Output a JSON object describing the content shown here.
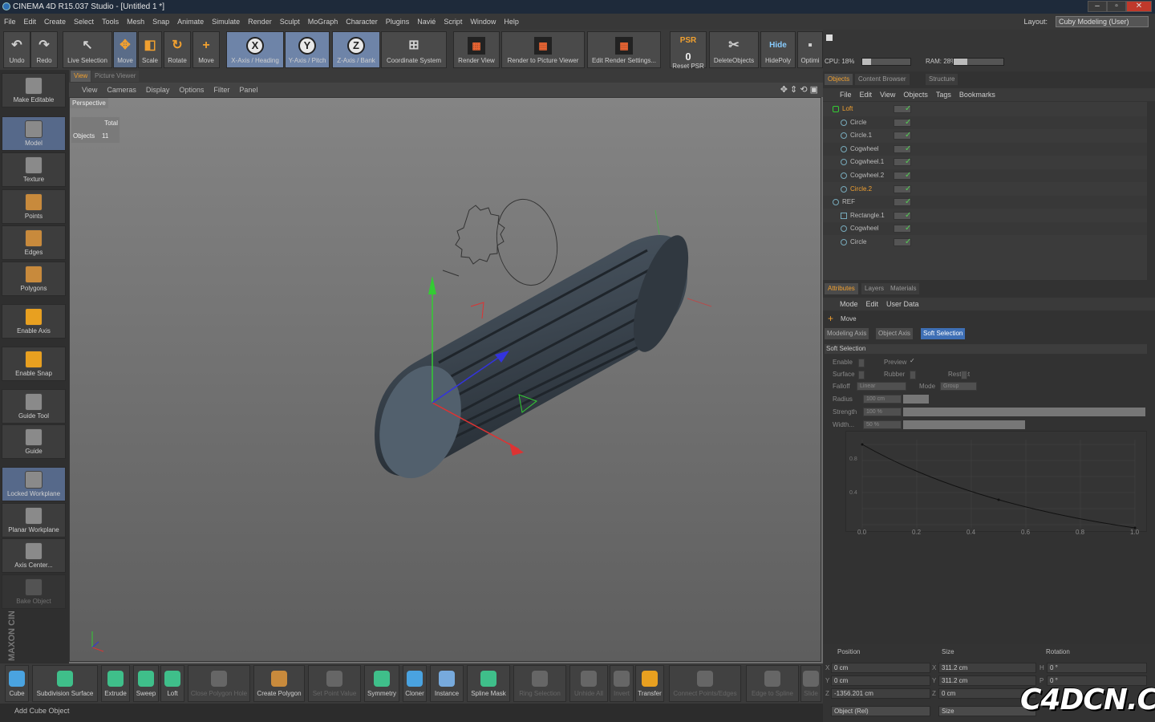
{
  "window": {
    "title": "CINEMA 4D R15.037 Studio - [Untitled 1 *]",
    "btns": [
      "–",
      "▫",
      "✕"
    ]
  },
  "menu": [
    "File",
    "Edit",
    "Create",
    "Select",
    "Tools",
    "Mesh",
    "Snap",
    "Animate",
    "Simulate",
    "Render",
    "Sculpt",
    "MoGraph",
    "Character",
    "Plugins",
    "Navié",
    "Script",
    "Window",
    "Help"
  ],
  "layout": {
    "label": "Layout:",
    "value": "Cuby Modeling (User)"
  },
  "toolbar": [
    {
      "label": "Undo",
      "icon": "↶"
    },
    {
      "label": "Redo",
      "icon": "↷"
    },
    {
      "label": "Live Selection",
      "icon": "↖"
    },
    {
      "label": "Move",
      "icon": "✥"
    },
    {
      "label": "Scale",
      "icon": "◧"
    },
    {
      "label": "Rotate",
      "icon": "↻"
    },
    {
      "label": "Move",
      "icon": "+"
    },
    {
      "label": "X-Axis / Heading",
      "icon": "X"
    },
    {
      "label": "Y-Axis / Pitch",
      "icon": "Y"
    },
    {
      "label": "Z-Axis / Bank",
      "icon": "Z"
    },
    {
      "label": "Coordinate System",
      "icon": "⊞"
    },
    {
      "label": "Render View",
      "icon": "▦"
    },
    {
      "label": "Render to Picture Viewer",
      "icon": "▦"
    },
    {
      "label": "Edit Render Settings...",
      "icon": "▦"
    },
    {
      "label": "Reset PSR",
      "icon": "PSR"
    },
    {
      "label": "DeleteObjects",
      "icon": "✂"
    },
    {
      "label": "HidePoly",
      "icon": "Hide"
    },
    {
      "label": "Optimi",
      "icon": "▪"
    }
  ],
  "psr_value": "0",
  "left_tools": [
    "Make Editable",
    "Model",
    "Texture",
    "Points",
    "Edges",
    "Polygons",
    "Enable Axis",
    "Enable Snap",
    "Guide Tool",
    "Guide",
    "Locked Workplane",
    "Planar Workplane",
    "Axis Center...",
    "Bake Object"
  ],
  "maxon": "MAXON CINEMA 4D",
  "viewport": {
    "tabs": [
      "View",
      "Picture Viewer"
    ],
    "menu": [
      "View",
      "Cameras",
      "Display",
      "Options",
      "Filter",
      "Panel"
    ],
    "camera": "Perspective",
    "stats": {
      "col": "Total",
      "row": "Objects",
      "value": "11"
    }
  },
  "perf": {
    "cpu": "CPU: 18%",
    "ram": "RAM: 28%",
    "cpu_level": 0.18,
    "ram_level": 0.28
  },
  "obj_tabs": [
    "Objects",
    "Content Browser",
    "Structure"
  ],
  "obj_menu": [
    "File",
    "Edit",
    "View",
    "Objects",
    "Tags",
    "Bookmarks"
  ],
  "objects": [
    {
      "name": "Loft",
      "indent": 0,
      "hl": true
    },
    {
      "name": "Circle",
      "indent": 1
    },
    {
      "name": "Circle.1",
      "indent": 1
    },
    {
      "name": "Cogwheel",
      "indent": 1
    },
    {
      "name": "Cogwheel.1",
      "indent": 1
    },
    {
      "name": "Cogwheel.2",
      "indent": 1
    },
    {
      "name": "Circle.2",
      "indent": 1,
      "hl": true
    },
    {
      "name": "REF",
      "indent": 0
    },
    {
      "name": "Rectangle.1",
      "indent": 1
    },
    {
      "name": "Cogwheel",
      "indent": 1
    },
    {
      "name": "Circle",
      "indent": 1
    }
  ],
  "attr_tabs": [
    "Attributes",
    "Layers",
    "Materials"
  ],
  "attr_menu": [
    "Mode",
    "Edit",
    "User Data"
  ],
  "tool_name": "Move",
  "attr_subtabs": [
    "Modeling Axis",
    "Object Axis",
    "Soft Selection"
  ],
  "soft": {
    "title": "Soft Selection",
    "enable": "Enable",
    "preview": "Preview",
    "surface": "Surface",
    "rubber": "Rubber",
    "restrict": "Restrict",
    "falloff": "Falloff",
    "falloff_val": "Linear",
    "mode": "Mode",
    "mode_val": "Group",
    "radius": "Radius",
    "radius_val": "100 cm",
    "strength": "Strength",
    "strength_val": "100 %",
    "width": "Width...",
    "width_val": "50 %",
    "yticks": [
      "0.8",
      "0.4"
    ],
    "xticks": [
      "0.0",
      "0.2",
      "0.4",
      "0.6",
      "0.8",
      "1.0"
    ]
  },
  "coord": {
    "position": "Position",
    "size": "Size",
    "rotation": "Rotation",
    "x": "0 cm",
    "y": "0 cm",
    "z": "-1356.201 cm",
    "sx": "311.2 cm",
    "sy": "311.2 cm",
    "sz": "0 cm",
    "h": "0 °",
    "p": "0 °",
    "mode": "Object (Rel)",
    "mode2": "Size"
  },
  "bottom": [
    {
      "label": "Cube",
      "color": "#4aa3e0"
    },
    {
      "label": "Subdivision Surface",
      "color": "#3fbf8a"
    },
    {
      "label": "Extrude",
      "color": "#3fbf8a"
    },
    {
      "label": "Sweep",
      "color": "#3fbf8a"
    },
    {
      "label": "Loft",
      "color": "#3fbf8a"
    },
    {
      "label": "Close Polygon Hole",
      "color": "#666",
      "dim": true
    },
    {
      "label": "Create Polygon",
      "color": "#c88a3c"
    },
    {
      "label": "Set Point Value",
      "color": "#666",
      "dim": true
    },
    {
      "label": "Symmetry",
      "color": "#3fbf8a"
    },
    {
      "label": "Cloner",
      "color": "#4aa3e0"
    },
    {
      "label": "Instance",
      "color": "#7ad"
    },
    {
      "label": "Spline Mask",
      "color": "#3fbf8a"
    },
    {
      "label": "Ring Selection",
      "color": "#666",
      "dim": true
    },
    {
      "label": "Unhide All",
      "color": "#666",
      "dim": true
    },
    {
      "label": "Invert",
      "color": "#666",
      "dim": true
    },
    {
      "label": "Transfer",
      "color": "#e8a020"
    },
    {
      "label": "Connect Points/Edges",
      "color": "#666",
      "dim": true
    },
    {
      "label": "Edge to Spline",
      "color": "#666",
      "dim": true
    },
    {
      "label": "Slide",
      "color": "#666",
      "dim": true
    }
  ],
  "status": "Add Cube Object",
  "watermark": "C4DCN.COM"
}
